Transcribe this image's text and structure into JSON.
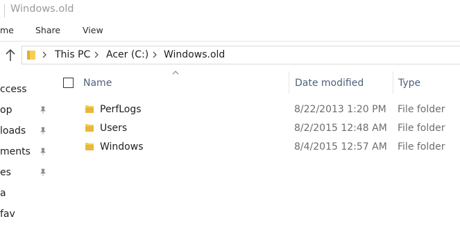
{
  "window": {
    "title": "Windows.old"
  },
  "ribbon": {
    "tabs": [
      "me",
      "Share",
      "View"
    ]
  },
  "address": {
    "crumbs": [
      "This PC",
      "Acer (C:)",
      "Windows.old"
    ]
  },
  "nav": {
    "items": [
      {
        "label": "ccess",
        "pinned": false
      },
      {
        "label": "op",
        "pinned": true
      },
      {
        "label": "loads",
        "pinned": true
      },
      {
        "label": "ments",
        "pinned": true
      },
      {
        "label": "es",
        "pinned": true
      },
      {
        "label": "a",
        "pinned": false
      },
      {
        "label": "fav",
        "pinned": false
      }
    ]
  },
  "columns": {
    "name": "Name",
    "date": "Date modified",
    "type": "Type"
  },
  "files": [
    {
      "name": "PerfLogs",
      "date": "8/22/2013 1:20 PM",
      "type": "File folder"
    },
    {
      "name": "Users",
      "date": "8/2/2015 12:48 AM",
      "type": "File folder"
    },
    {
      "name": "Windows",
      "date": "8/4/2015 12:57 AM",
      "type": "File folder"
    }
  ],
  "colors": {
    "folder": "#e8b73b",
    "header_text": "#4d5f7a",
    "secondary_text": "#6d6d6d"
  },
  "icons": {
    "up": "up-arrow-icon",
    "folder": "folder-icon",
    "pin": "pin-icon",
    "chevron": "chevron-right-icon"
  }
}
